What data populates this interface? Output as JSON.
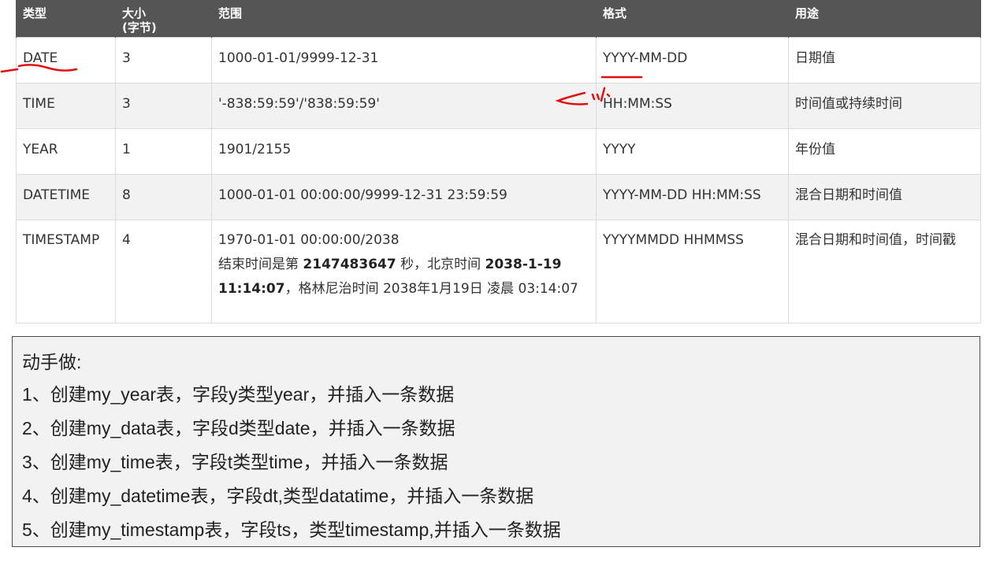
{
  "table": {
    "headers": [
      "类型",
      "大小\n(字节)",
      "范围",
      "格式",
      "用途"
    ],
    "rows": [
      {
        "type": "DATE",
        "size": "3",
        "range": [
          "1000-01-01/9999-12-31"
        ],
        "format": "YYYY-MM-DD",
        "use": "日期值"
      },
      {
        "type": "TIME",
        "size": "3",
        "range": [
          "'-838:59:59'/'838:59:59'"
        ],
        "format": "HH:MM:SS",
        "use": "时间值或持续时间"
      },
      {
        "type": "YEAR",
        "size": "1",
        "range": [
          "1901/2155"
        ],
        "format": "YYYY",
        "use": "年份值"
      },
      {
        "type": "DATETIME",
        "size": "8",
        "range": [
          "1000-01-01 00:00:00/9999-12-31 23:59:59"
        ],
        "format": "YYYY-MM-DD HH:MM:SS",
        "use": "混合日期和时间值"
      },
      {
        "type": "TIMESTAMP",
        "size": "4",
        "range": [
          "1970-01-01 00:00:00/2038"
        ],
        "range_note": {
          "p1": "结束时间是第 ",
          "b1": "2147483647",
          "p2": " 秒，北京时间 ",
          "b2": "2038-1-19 11:14:07",
          "p3": "，格林尼治时间 2038年1月19日 凌晨 03:14:07"
        },
        "format": "YYYYMMDD HHMMSS",
        "use": "混合日期和时间值，时间戳"
      }
    ]
  },
  "exercise": {
    "title": "动手做:",
    "items": [
      "1、创建my_year表，字段y类型year，并插入一条数据",
      "2、创建my_data表，字段d类型date，并插入一条数据",
      "3、创建my_time表，字段t类型time，并插入一条数据",
      "4、创建my_datetime表，字段dt,类型datatime，并插入一条数据",
      "5、创建my_timestamp表，字段ts，类型timestamp,并插入一条数据"
    ]
  },
  "colors": {
    "header_bg": "#555555",
    "alt_row_bg": "#f2f2f2",
    "annotation_red": "#e01010",
    "exercise_bg": "#f2f2f2"
  }
}
